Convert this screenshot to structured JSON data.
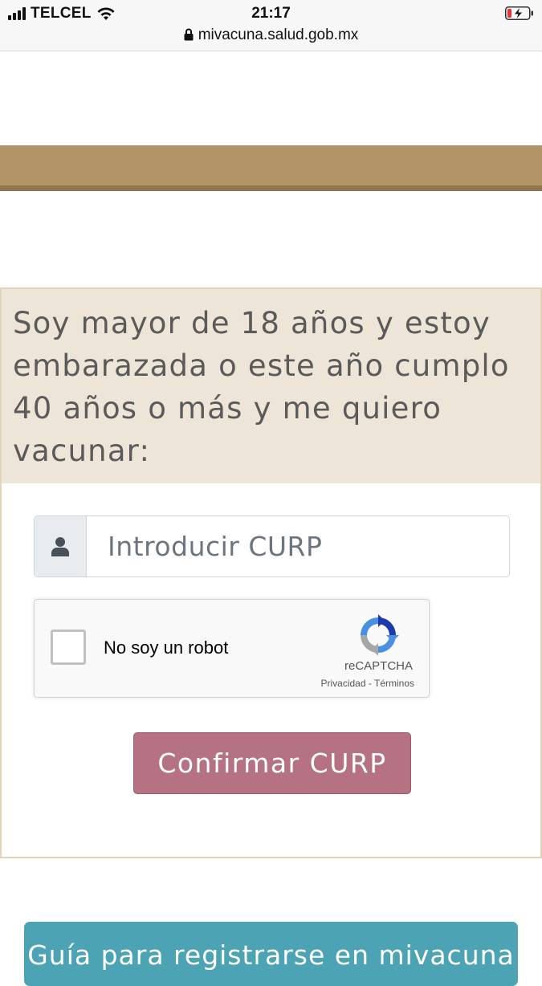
{
  "status_bar": {
    "carrier": "TELCEL",
    "time": "21:17",
    "url": "mivacuna.salud.gob.mx"
  },
  "form": {
    "heading": "Soy mayor de 18 años y estoy embarazada o este año cumplo 40 años o más y me quiero vacunar:",
    "curp_placeholder": "Introducir CURP",
    "curp_value": "",
    "recaptcha": {
      "label": "No soy un robot",
      "brand": "reCAPTCHA",
      "privacy": "Privacidad",
      "separator": "-",
      "terms": "Términos",
      "checked": false
    },
    "confirm_label": "Confirmar CURP"
  },
  "guide_button_label": "Guía para registrarse en mivacuna",
  "colors": {
    "brand_band": "#b39466",
    "card_header_bg": "#ede5d8",
    "confirm_button": "#b47283",
    "guide_button": "#4ba3b4"
  }
}
